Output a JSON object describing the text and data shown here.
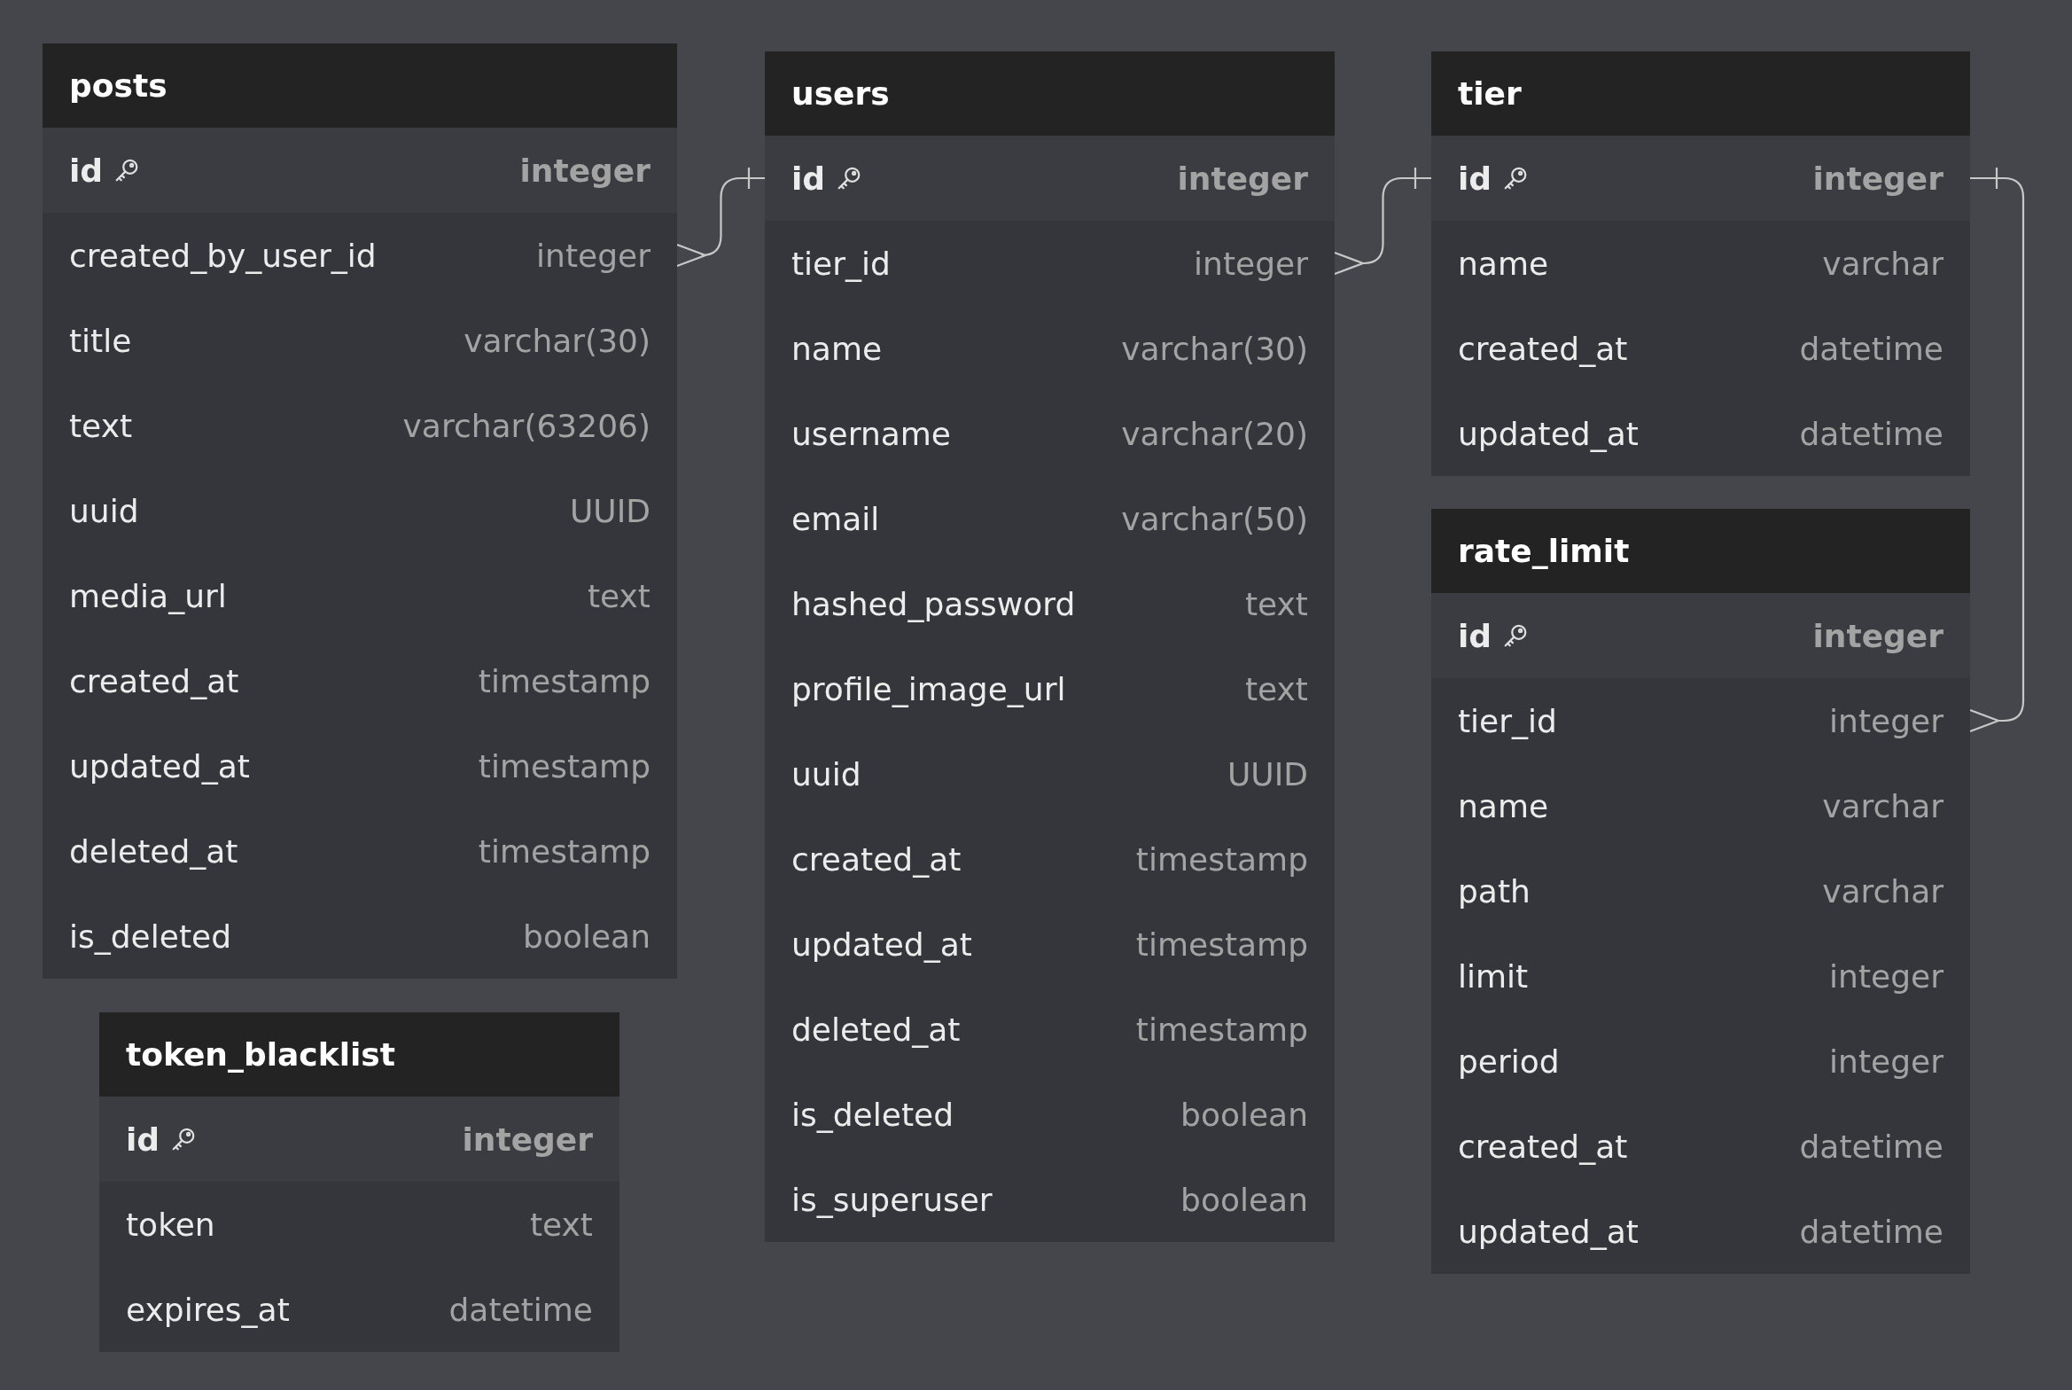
{
  "tables": [
    {
      "name": "posts",
      "columns": [
        {
          "name": "id",
          "type": "integer",
          "primary_key": true
        },
        {
          "name": "created_by_user_id",
          "type": "integer",
          "primary_key": false
        },
        {
          "name": "title",
          "type": "varchar(30)",
          "primary_key": false
        },
        {
          "name": "text",
          "type": "varchar(63206)",
          "primary_key": false
        },
        {
          "name": "uuid",
          "type": "UUID",
          "primary_key": false
        },
        {
          "name": "media_url",
          "type": "text",
          "primary_key": false
        },
        {
          "name": "created_at",
          "type": "timestamp",
          "primary_key": false
        },
        {
          "name": "updated_at",
          "type": "timestamp",
          "primary_key": false
        },
        {
          "name": "deleted_at",
          "type": "timestamp",
          "primary_key": false
        },
        {
          "name": "is_deleted",
          "type": "boolean",
          "primary_key": false
        }
      ]
    },
    {
      "name": "users",
      "columns": [
        {
          "name": "id",
          "type": "integer",
          "primary_key": true
        },
        {
          "name": "tier_id",
          "type": "integer",
          "primary_key": false
        },
        {
          "name": "name",
          "type": "varchar(30)",
          "primary_key": false
        },
        {
          "name": "username",
          "type": "varchar(20)",
          "primary_key": false
        },
        {
          "name": "email",
          "type": "varchar(50)",
          "primary_key": false
        },
        {
          "name": "hashed_password",
          "type": "text",
          "primary_key": false
        },
        {
          "name": "profile_image_url",
          "type": "text",
          "primary_key": false
        },
        {
          "name": "uuid",
          "type": "UUID",
          "primary_key": false
        },
        {
          "name": "created_at",
          "type": "timestamp",
          "primary_key": false
        },
        {
          "name": "updated_at",
          "type": "timestamp",
          "primary_key": false
        },
        {
          "name": "deleted_at",
          "type": "timestamp",
          "primary_key": false
        },
        {
          "name": "is_deleted",
          "type": "boolean",
          "primary_key": false
        },
        {
          "name": "is_superuser",
          "type": "boolean",
          "primary_key": false
        }
      ]
    },
    {
      "name": "tier",
      "columns": [
        {
          "name": "id",
          "type": "integer",
          "primary_key": true
        },
        {
          "name": "name",
          "type": "varchar",
          "primary_key": false
        },
        {
          "name": "created_at",
          "type": "datetime",
          "primary_key": false
        },
        {
          "name": "updated_at",
          "type": "datetime",
          "primary_key": false
        }
      ]
    },
    {
      "name": "rate_limit",
      "columns": [
        {
          "name": "id",
          "type": "integer",
          "primary_key": true
        },
        {
          "name": "tier_id",
          "type": "integer",
          "primary_key": false
        },
        {
          "name": "name",
          "type": "varchar",
          "primary_key": false
        },
        {
          "name": "path",
          "type": "varchar",
          "primary_key": false
        },
        {
          "name": "limit",
          "type": "integer",
          "primary_key": false
        },
        {
          "name": "period",
          "type": "integer",
          "primary_key": false
        },
        {
          "name": "created_at",
          "type": "datetime",
          "primary_key": false
        },
        {
          "name": "updated_at",
          "type": "datetime",
          "primary_key": false
        }
      ]
    },
    {
      "name": "token_blacklist",
      "columns": [
        {
          "name": "id",
          "type": "integer",
          "primary_key": true
        },
        {
          "name": "token",
          "type": "text",
          "primary_key": false
        },
        {
          "name": "expires_at",
          "type": "datetime",
          "primary_key": false
        }
      ]
    }
  ]
}
